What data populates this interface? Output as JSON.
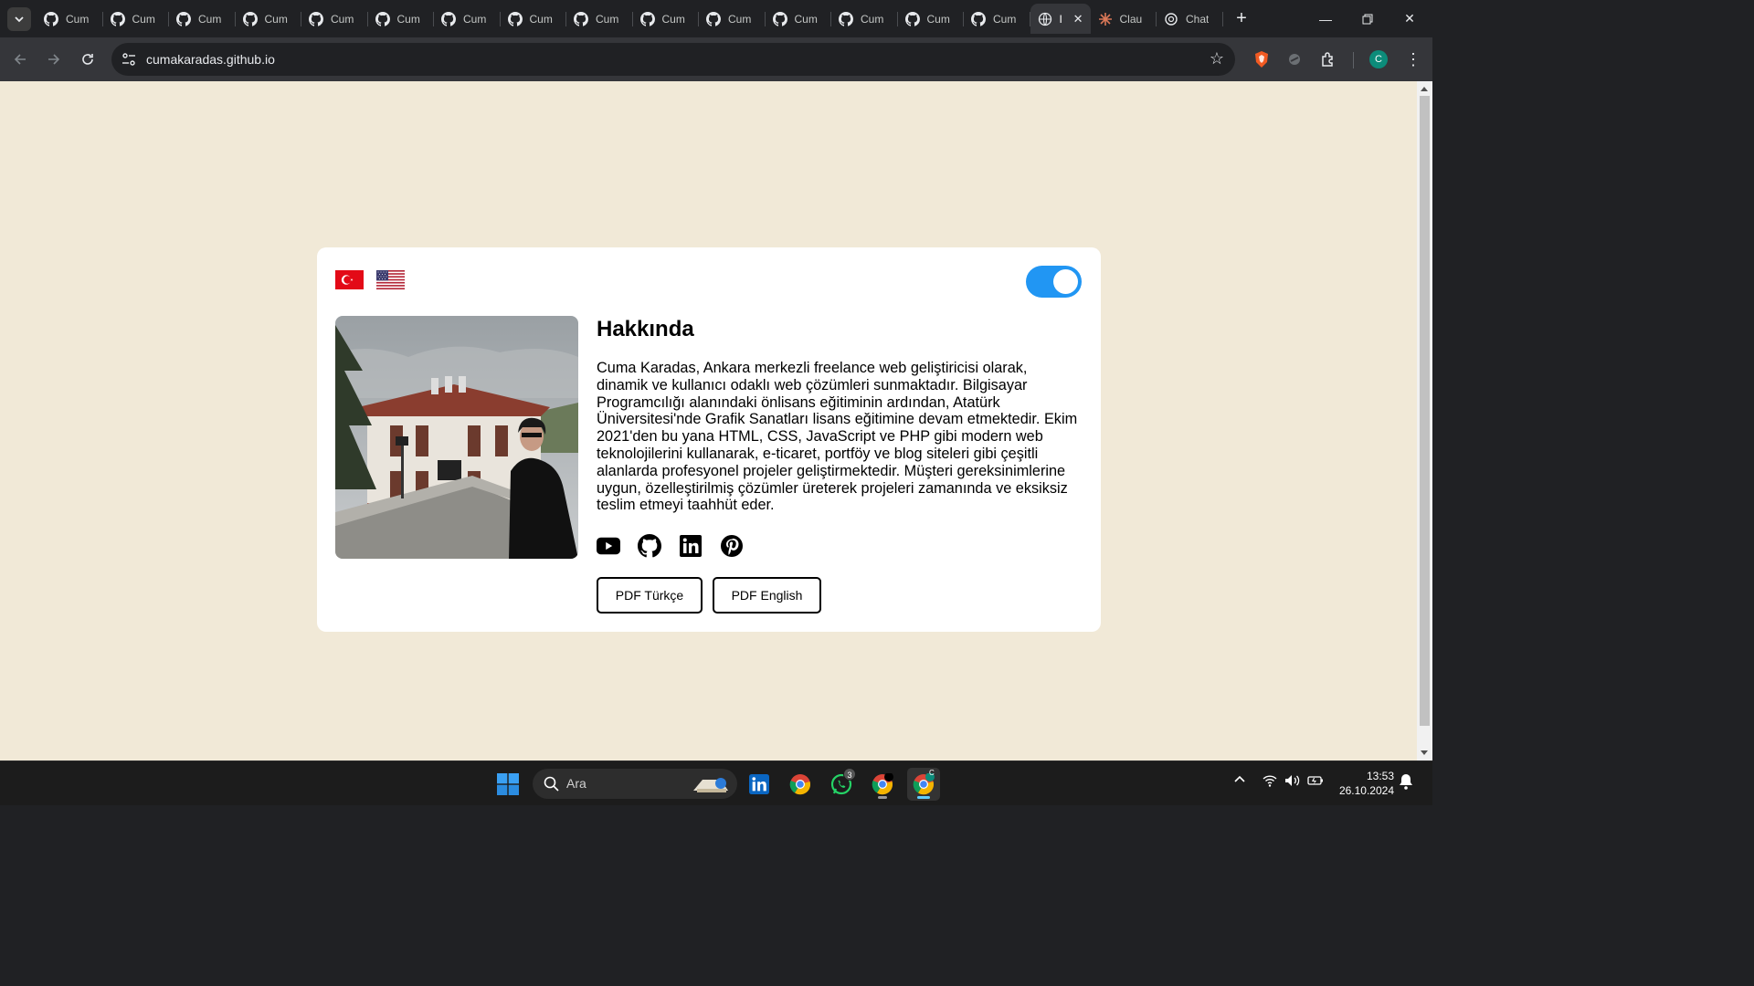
{
  "browser": {
    "tabs": [
      {
        "title": "Cum",
        "favicon": "github-icon"
      },
      {
        "title": "Cum",
        "favicon": "github-icon"
      },
      {
        "title": "Cum",
        "favicon": "github-icon"
      },
      {
        "title": "Cum",
        "favicon": "github-icon"
      },
      {
        "title": "Cum",
        "favicon": "github-icon"
      },
      {
        "title": "Cum",
        "favicon": "github-icon"
      },
      {
        "title": "Cum",
        "favicon": "github-icon"
      },
      {
        "title": "Cum",
        "favicon": "github-icon"
      },
      {
        "title": "Cum",
        "favicon": "github-icon"
      },
      {
        "title": "Cum",
        "favicon": "github-icon"
      },
      {
        "title": "Cum",
        "favicon": "github-icon"
      },
      {
        "title": "Cum",
        "favicon": "github-icon"
      },
      {
        "title": "Cum",
        "favicon": "github-icon"
      },
      {
        "title": "Cum",
        "favicon": "github-icon"
      },
      {
        "title": "Cum",
        "favicon": "github-icon"
      },
      {
        "title": "I",
        "favicon": "globe-icon",
        "active": true
      },
      {
        "title": "Clau",
        "favicon": "claude-icon"
      },
      {
        "title": "Chat",
        "favicon": "chatgpt-icon"
      }
    ],
    "url": "cumakaradas.github.io",
    "profile_initial": "C",
    "accent_color": "#0c8c7a"
  },
  "page": {
    "heading": "Hakkında",
    "bio": "Cuma Karadas, Ankara merkezli freelance web geliştiricisi olarak, dinamik ve kullanıcı odaklı web çözümleri sunmaktadır. Bilgisayar Programcılığı alanındaki önlisans eğitiminin ardından, Atatürk Üniversitesi'nde Grafik Sanatları lisans eğitimine devam etmektedir. Ekim 2021'den bu yana HTML, CSS, JavaScript ve PHP gibi modern web teknolojilerini kullanarak, e-ticaret, portföy ve blog siteleri gibi çeşitli alanlarda profesyonel projeler geliştirmektedir. Müşteri gereksinimlerine uygun, özelleştirilmiş çözümler üreterek projeleri zamanında ve eksiksiz teslim etmeyi taahhüt eder.",
    "languages": [
      "turkey-flag",
      "usa-flag"
    ],
    "theme_toggle_on": true,
    "toggle_color": "#2196f3",
    "socials": [
      "youtube-icon",
      "github-icon",
      "linkedin-icon",
      "pinterest-icon"
    ],
    "buttons": {
      "pdf_tr": "PDF Türkçe",
      "pdf_en": "PDF English"
    },
    "background_color": "#f1e9d7"
  },
  "taskbar": {
    "search_placeholder": "Ara",
    "whatsapp_badge": "3",
    "chrome_profile_initial": "C",
    "time": "13:53",
    "date": "26.10.2024"
  }
}
